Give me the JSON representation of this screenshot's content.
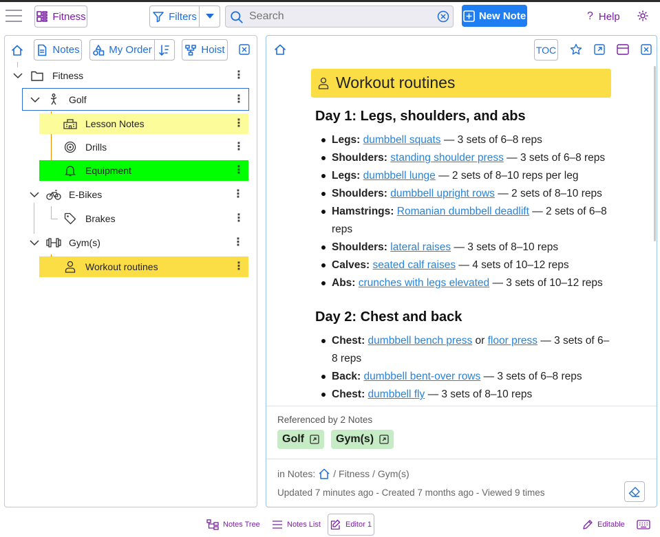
{
  "toolbar": {
    "workspace_label": "Fitness",
    "filters_label": "Filters",
    "search_placeholder": "Search",
    "new_note_label": "New Note",
    "help_label": "Help"
  },
  "tree_toolbar": {
    "notes_label": "Notes",
    "order_label": "My Order",
    "hoist_label": "Hoist"
  },
  "tree": {
    "root": "Fitness",
    "golf": "Golf",
    "lesson_notes": "Lesson Notes",
    "drills": "Drills",
    "equipment": "Equipment",
    "ebikes": "E-Bikes",
    "brakes": "Brakes",
    "gyms": "Gym(s)",
    "workout": "Workout routines"
  },
  "editor": {
    "toc_label": "TOC",
    "title": "Workout routines",
    "day1_heading": "Day 1: Legs, shoulders, and abs",
    "day1": [
      {
        "label": "Legs:",
        "link": "dumbbell squats",
        "rest": " — 3 sets of 6–8 reps"
      },
      {
        "label": "Shoulders:",
        "link": "standing shoulder press",
        "rest": " — 3 sets of 6–8 reps"
      },
      {
        "label": "Legs:",
        "link": "dumbbell lunge",
        "rest": " — 2 sets of 8–10 reps per leg"
      },
      {
        "label": "Shoulders:",
        "link": "dumbbell upright rows",
        "rest": " — 2 sets of 8–10 reps"
      },
      {
        "label": "Hamstrings:",
        "link": "Romanian dumbbell deadlift",
        "rest": " — 2 sets of 6–8 reps"
      },
      {
        "label": "Shoulders:",
        "link": "lateral raises",
        "rest": " — 3 sets of 8–10 reps"
      },
      {
        "label": "Calves:",
        "link": "seated calf raises",
        "rest": " — 4 sets of 10–12 reps"
      },
      {
        "label": "Abs:",
        "link": "crunches with legs elevated",
        "rest": " — 3 sets of 10–12 reps"
      }
    ],
    "day2_heading": "Day 2: Chest and back",
    "day2_chest_label": "Chest:",
    "day2_chest_link1": "dumbbell bench press",
    "day2_chest_or": " or ",
    "day2_chest_link2": "floor press",
    "day2_chest_rest": " — 3 sets of 6–8 reps",
    "day2_back_label": "Back:",
    "day2_back_link": "dumbbell bent-over rows",
    "day2_back_rest": " — 3 sets of 6–8 reps",
    "day2_chest2_label": "Chest:",
    "day2_chest2_link": "dumbbell fly",
    "day2_chest2_rest": " — 3 sets of 8–10 reps"
  },
  "references": {
    "heading": "Referenced by 2 Notes",
    "chips": [
      "Golf",
      "Gym(s)"
    ]
  },
  "meta": {
    "path_prefix": "in Notes:",
    "path_rest": " / Fitness / Gym(s)",
    "info": "Updated 7 minutes ago - Created 7 months ago - Viewed 9 times"
  },
  "footer": {
    "notes_tree": "Notes Tree",
    "notes_list": "Notes List",
    "editor": "Editor 1",
    "editable": "Editable"
  },
  "colors": {
    "accent_purple": "#7a1fa2",
    "accent_blue": "#1e6fd9",
    "highlight_yellow": "#fdfc9b",
    "highlight_green": "#00ff00",
    "highlight_gold": "#fbdd45",
    "link_blue": "#2a83d6",
    "chip_green": "#c6ecc6"
  }
}
